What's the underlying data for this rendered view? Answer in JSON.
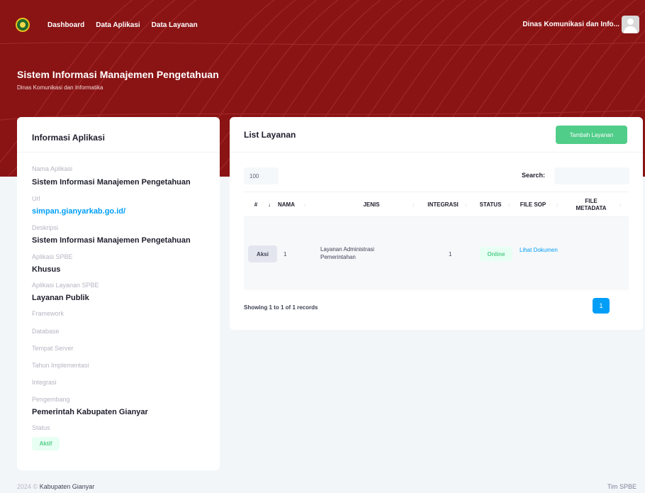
{
  "nav": {
    "items": [
      {
        "label": "Dashboard"
      },
      {
        "label": "Data Aplikasi"
      },
      {
        "label": "Data Layanan"
      }
    ],
    "user_name": "Dinas Komunikasi dan Info..."
  },
  "header": {
    "title": "Sistem Informasi Manajemen Pengetahuan",
    "subtitle": "Dinas Komunikasi dan Informatika"
  },
  "info_card": {
    "title": "Informasi Aplikasi",
    "fields": {
      "nama_label": "Nama Aplikasi",
      "nama_value": "Sistem Informasi Manajemen Pengetahuan",
      "url_label": "Url",
      "url_value": "simpan.gianyarkab.go.id/",
      "deskripsi_label": "Deskripsi",
      "deskripsi_value": "Sistem Informasi Manajemen Pengetahuan",
      "spbe_label": "Aplikasi SPBE",
      "spbe_value": "Khusus",
      "layanan_label": "Aplikasi Layanan SPBE",
      "layanan_value": "Layanan Publik",
      "framework_label": "Framework",
      "database_label": "Database",
      "server_label": "Tempat Server",
      "tahun_label": "Tahun Implementasi",
      "integrasi_label": "Integrasi",
      "pengembang_label": "Pengembang",
      "pengembang_value": "Pemerintah Kabupaten Gianyar",
      "status_label": "Status",
      "status_value": "Aktif"
    }
  },
  "layanan_card": {
    "title": "List Layanan",
    "add_button": "Tambah Layanan",
    "page_size": "100",
    "search_label": "Search:",
    "search_value": "",
    "columns": [
      "#",
      "NAMA",
      "JENIS",
      "INTEGRASI",
      "STATUS",
      "FILE SOP",
      "FILE METADATA"
    ],
    "rows": [
      {
        "action": "Aksi",
        "nama": "1",
        "jenis": "Layanan Administrasi Pemerintahan",
        "integrasi": "1",
        "status": "Online",
        "file_sop": "Lihat Dokumen",
        "file_metadata": ""
      }
    ],
    "showing": "Showing 1 to 1 of 1 records",
    "current_page": "1"
  },
  "footer": {
    "year": "2024",
    "copyright": "©",
    "org": "Kabupaten Gianyar",
    "team": "Tim SPBE"
  },
  "colors": {
    "header_bg": "#8a1314",
    "success": "#50cd89",
    "primary": "#009ef7"
  }
}
